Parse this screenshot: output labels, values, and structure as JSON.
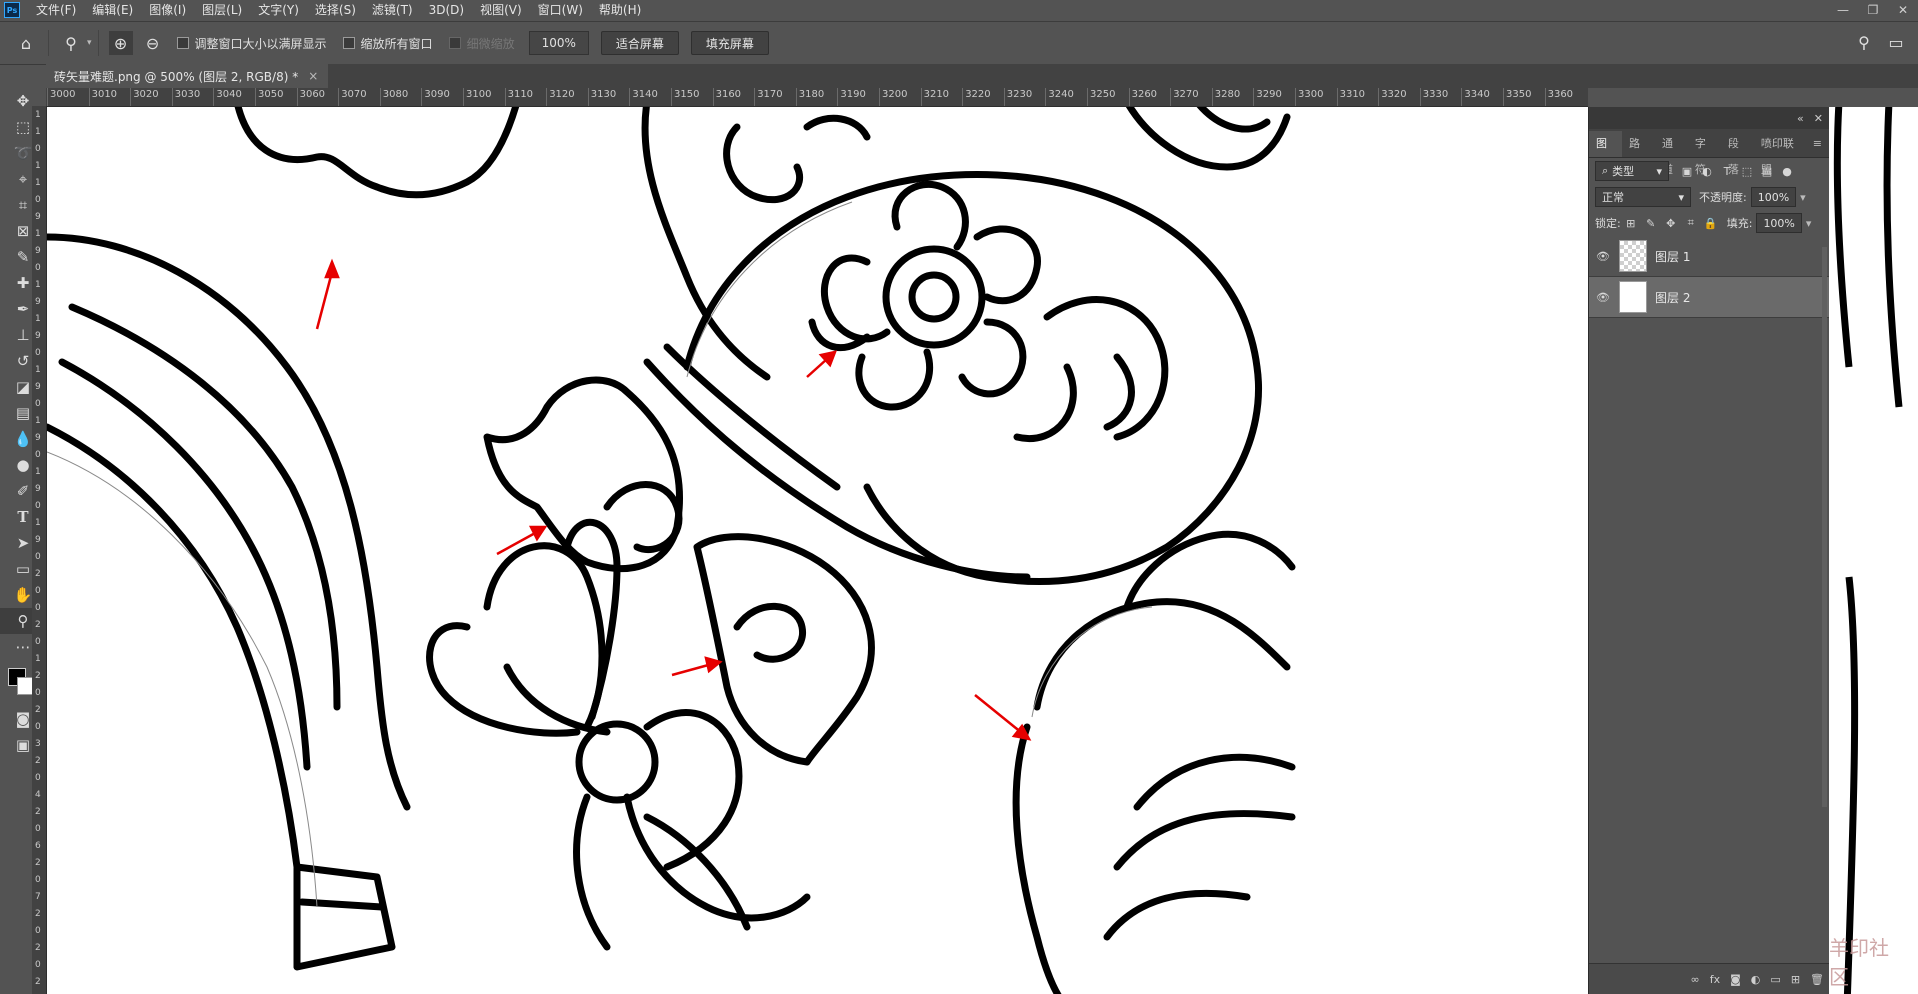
{
  "app": {
    "logo": "Ps"
  },
  "menu": [
    "文件(F)",
    "编辑(E)",
    "图像(I)",
    "图层(L)",
    "文字(Y)",
    "选择(S)",
    "滤镜(T)",
    "3D(D)",
    "视图(V)",
    "窗口(W)",
    "帮助(H)"
  ],
  "window_controls": {
    "minimize": "—",
    "restore": "❐",
    "close": "✕"
  },
  "options": {
    "home_icon": "home-icon",
    "zoom_icon": "zoom-icon",
    "resize_windows": "调整窗口大小以满屏显示",
    "zoom_all": "缩放所有窗口",
    "scrubby_zoom": "细微缩放",
    "zoom_value": "100%",
    "fit_screen": "适合屏幕",
    "fill_screen": "填充屏幕"
  },
  "document": {
    "tab_title": "砖矢量难题.png @ 500% (图层 2, RGB/8) *",
    "close": "×"
  },
  "ruler_h": [
    "3000",
    "3010",
    "3020",
    "3030",
    "3040",
    "3050",
    "3060",
    "3070",
    "3080",
    "3090",
    "3100",
    "3110",
    "3120",
    "3130",
    "3140",
    "3150",
    "3160",
    "3170",
    "3180",
    "3190",
    "3200",
    "3210",
    "3220",
    "3230",
    "3240",
    "3250",
    "3260",
    "3270",
    "3280",
    "3290",
    "3300",
    "3310",
    "3320",
    "3330",
    "3340",
    "3350",
    "3360"
  ],
  "ruler_v": [
    "1",
    "1",
    "0",
    "1",
    "1",
    "0",
    "9",
    "1",
    "9",
    "0",
    "1",
    "9",
    "1",
    "9",
    "0",
    "1",
    "9",
    "0",
    "1",
    "9",
    "0",
    "1",
    "9",
    "0",
    "1",
    "9",
    "0",
    "2",
    "0",
    "0",
    "2",
    "0",
    "1",
    "2",
    "0",
    "2",
    "0",
    "3",
    "2",
    "0",
    "4",
    "2",
    "0",
    "6",
    "2",
    "0",
    "7",
    "2",
    "0",
    "2",
    "0",
    "2"
  ],
  "panel": {
    "tabs": [
      "图层",
      "路径",
      "通道",
      "字符",
      "段落",
      "喷印联盟"
    ],
    "active_tab": "图层",
    "filter_kind": "类型",
    "blend_mode": "正常",
    "opacity_label": "不透明度:",
    "opacity_value": "100%",
    "lock_label": "锁定:",
    "fill_label": "填充:",
    "fill_value": "100%",
    "layers": [
      {
        "name": "图层 1",
        "selected": false
      },
      {
        "name": "图层 2",
        "selected": true
      }
    ]
  },
  "watermark": "羊印社区"
}
